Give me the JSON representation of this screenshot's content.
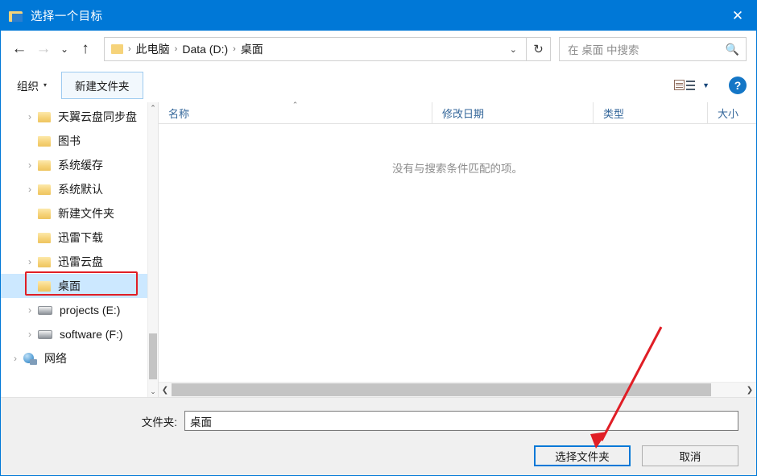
{
  "window": {
    "title": "选择一个目标",
    "icon": "folder-icon",
    "close_label": "✕"
  },
  "nav": {
    "back": "←",
    "forward": "→",
    "recent": "⌄",
    "up": "↑",
    "refresh": "↻",
    "dropdown": "⌄"
  },
  "breadcrumb": {
    "items": [
      "此电脑",
      "Data (D:)",
      "桌面"
    ],
    "separator": "›"
  },
  "search": {
    "placeholder": "在 桌面 中搜索",
    "icon": "search-icon"
  },
  "toolbar": {
    "organize_label": "组织",
    "organize_caret": "▾",
    "new_folder_label": "新建文件夹",
    "view_caret": "▼",
    "help_label": "?"
  },
  "sidebar": {
    "items": [
      {
        "label": "天翼云盘同步盘",
        "icon": "folder-icon",
        "expandable": true,
        "indent": 1,
        "selected": false
      },
      {
        "label": "图书",
        "icon": "folder-icon",
        "expandable": false,
        "indent": 1,
        "selected": false
      },
      {
        "label": "系统缓存",
        "icon": "folder-icon",
        "expandable": true,
        "indent": 1,
        "selected": false
      },
      {
        "label": "系统默认",
        "icon": "folder-icon",
        "expandable": true,
        "indent": 1,
        "selected": false
      },
      {
        "label": "新建文件夹",
        "icon": "folder-icon",
        "expandable": false,
        "indent": 1,
        "selected": false
      },
      {
        "label": "迅雷下载",
        "icon": "folder-icon",
        "expandable": false,
        "indent": 1,
        "selected": false
      },
      {
        "label": "迅雷云盘",
        "icon": "folder-icon",
        "expandable": true,
        "indent": 1,
        "selected": false
      },
      {
        "label": "桌面",
        "icon": "folder-icon",
        "expandable": false,
        "indent": 1,
        "selected": true
      },
      {
        "label": "projects (E:)",
        "icon": "drive-icon",
        "expandable": true,
        "indent": 1,
        "selected": false
      },
      {
        "label": "software (F:)",
        "icon": "drive-icon",
        "expandable": true,
        "indent": 1,
        "selected": false
      },
      {
        "label": "网络",
        "icon": "network-icon",
        "expandable": true,
        "indent": 0,
        "selected": false
      }
    ],
    "expander_glyph": "›",
    "scroll_up": "⌃",
    "scroll_down": "⌄"
  },
  "filelist": {
    "columns": [
      {
        "label": "名称",
        "sorted": true
      },
      {
        "label": "修改日期",
        "sorted": false
      },
      {
        "label": "类型",
        "sorted": false
      },
      {
        "label": "大小",
        "sorted": false
      }
    ],
    "sort_caret": "⌃",
    "empty_message": "没有与搜索条件匹配的项。",
    "rows": [],
    "scroll_left": "❮",
    "scroll_right": "❯"
  },
  "footer": {
    "folder_label": "文件夹:",
    "folder_value": "桌面",
    "select_button": "选择文件夹",
    "cancel_button": "取消"
  },
  "annotations": {
    "highlight_color": "#e01e26",
    "arrow_from": "820,405",
    "arrow_to": "740,552"
  },
  "colors": {
    "accent": "#0078d7",
    "selection": "#cce8ff",
    "annotation": "#e01e26"
  }
}
